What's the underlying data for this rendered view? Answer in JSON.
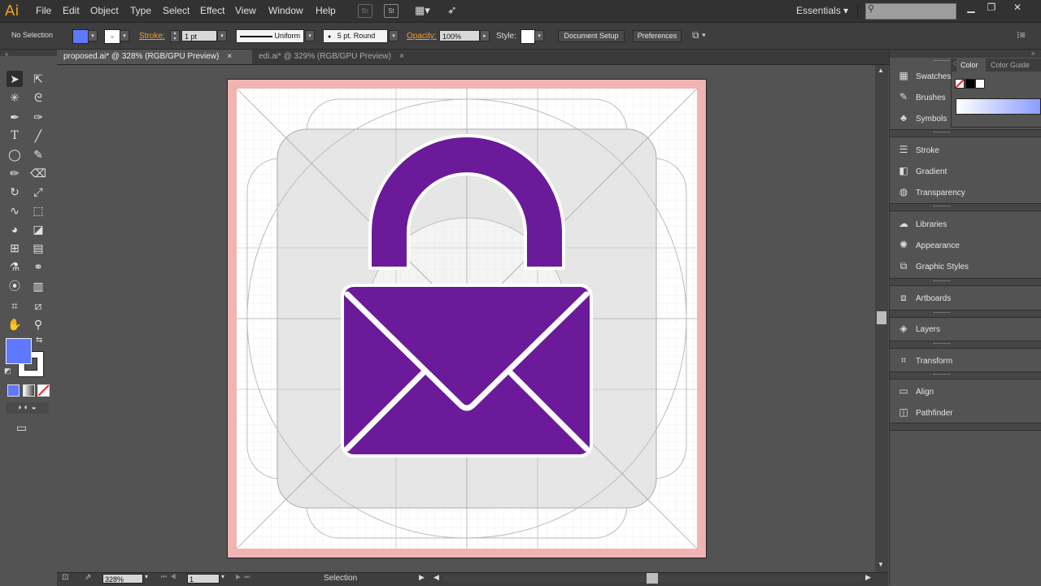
{
  "app": {
    "logo": "Ai"
  },
  "menu": [
    "File",
    "Edit",
    "Object",
    "Type",
    "Select",
    "Effect",
    "View",
    "Window",
    "Help"
  ],
  "menubar": {
    "bridge_icon": "Br",
    "stock_icon": "St",
    "workspace": "Essentials",
    "search_placeholder": ""
  },
  "control": {
    "selection": "No Selection",
    "stroke_label": "Stroke:",
    "stroke_weight": "1 pt",
    "profile": "Uniform",
    "brush": "5 pt. Round",
    "opacity_label": "Opacity:",
    "opacity": "100%",
    "style_label": "Style:",
    "document_setup": "Document Setup",
    "preferences": "Preferences",
    "fill_color": "#5e78ff"
  },
  "tabs": [
    {
      "label": "proposed.ai* @ 328% (RGB/GPU Preview)",
      "close": "×"
    },
    {
      "label": "edi.ai* @ 329% (RGB/GPU Preview)",
      "close": "×"
    }
  ],
  "status": {
    "zoom": "328%",
    "artboard": "1",
    "tool": "Selection"
  },
  "color_panel": {
    "tab1": "Color",
    "tab2": "Color Guide"
  },
  "panels": [
    {
      "label": "Swatches",
      "icon": "grid-icon"
    },
    {
      "label": "Brushes",
      "icon": "brush-icon"
    },
    {
      "label": "Symbols",
      "icon": "club-icon"
    },
    {
      "label": "Stroke",
      "icon": "lines-icon"
    },
    {
      "label": "Gradient",
      "icon": "gradient-icon"
    },
    {
      "label": "Transparency",
      "icon": "transparency-icon"
    },
    {
      "label": "Libraries",
      "icon": "cloud-icon"
    },
    {
      "label": "Appearance",
      "icon": "sun-icon"
    },
    {
      "label": "Graphic Styles",
      "icon": "styles-icon"
    },
    {
      "label": "Artboards",
      "icon": "artboard-icon"
    },
    {
      "label": "Layers",
      "icon": "layers-icon"
    },
    {
      "label": "Transform",
      "icon": "transform-icon"
    },
    {
      "label": "Align",
      "icon": "align-icon"
    },
    {
      "label": "Pathfinder",
      "icon": "pathfinder-icon"
    }
  ],
  "artwork": {
    "lock_color": "#6b1a9a",
    "bleed_color": "#f2b3b3",
    "grid_color": "#dcdcdc"
  }
}
